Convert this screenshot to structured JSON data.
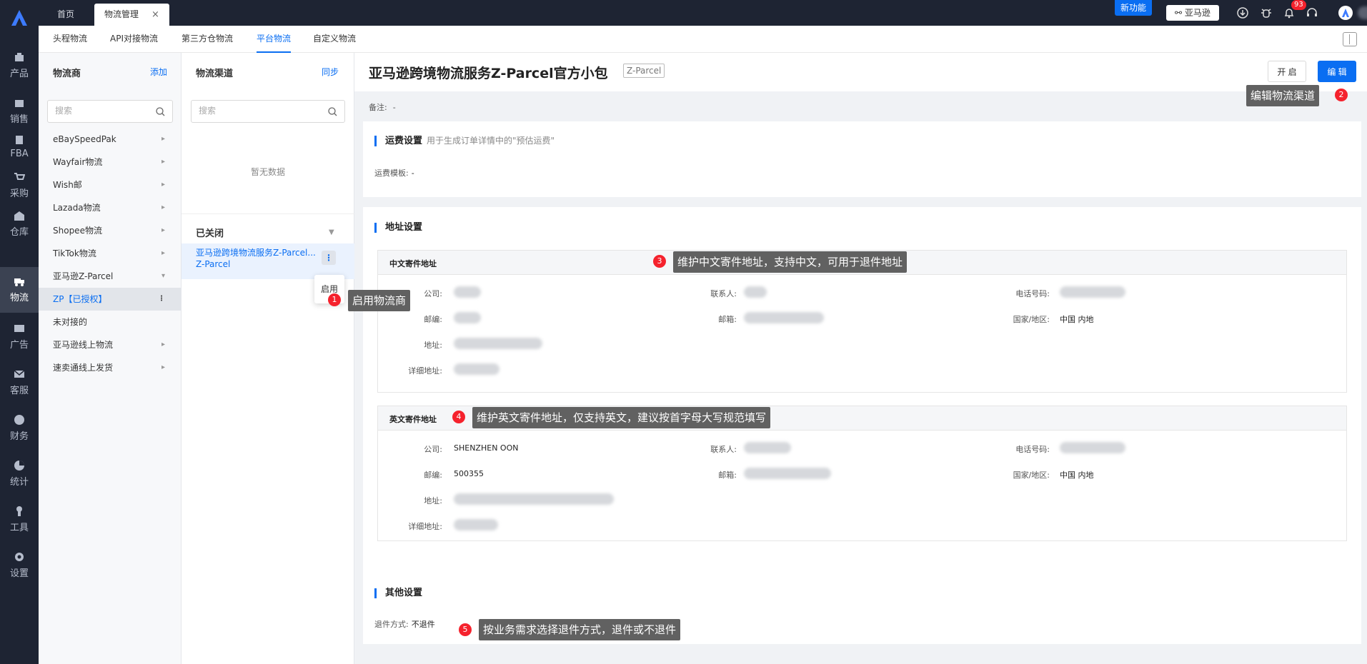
{
  "rail": {
    "items": [
      {
        "label": "产品",
        "icon": "product-icon"
      },
      {
        "label": "销售",
        "icon": "sales-icon"
      },
      {
        "label": "FBA",
        "icon": "fba-icon"
      },
      {
        "label": "采购",
        "icon": "cart-icon"
      },
      {
        "label": "仓库",
        "icon": "warehouse-icon"
      },
      {
        "label": "物流",
        "icon": "truck-icon"
      },
      {
        "label": "广告",
        "icon": "ad-icon"
      },
      {
        "label": "客服",
        "icon": "mail-icon"
      },
      {
        "label": "财务",
        "icon": "finance-icon"
      },
      {
        "label": "统计",
        "icon": "pie-icon"
      },
      {
        "label": "工具",
        "icon": "wrench-icon"
      },
      {
        "label": "设置",
        "icon": "gear-icon"
      }
    ]
  },
  "topbar": {
    "tabs": [
      {
        "label": "首页"
      },
      {
        "label": "物流管理",
        "close": "×"
      }
    ],
    "new_feature": "新功能",
    "amazon_btn": "亚马逊",
    "notif_count": "93"
  },
  "subnav": {
    "tabs": [
      "头程物流",
      "API对接物流",
      "第三方仓物流",
      "平台物流",
      "自定义物流"
    ],
    "active": "平台物流"
  },
  "providers": {
    "title": "物流商",
    "add": "添加",
    "search_placeholder": "搜索",
    "items": [
      "eBaySpeedPak",
      "Wayfair物流",
      "Wish邮",
      "Lazada物流",
      "Shopee物流",
      "TikTok物流",
      "亚马逊Z-Parcel",
      "ZP【已授权】",
      "未对接的",
      "亚马逊线上物流",
      "速卖通线上发货"
    ]
  },
  "channels": {
    "title": "物流渠道",
    "sync": "同步",
    "search_placeholder": "搜索",
    "empty": "暂无数据",
    "closed_title": "已关闭",
    "closed_item": "亚马逊跨境物流服务Z-Parcel...",
    "closed_item_sub": "Z-Parcel",
    "popup_enable": "启用"
  },
  "main": {
    "title": "亚马逊跨境物流服务Z-Parcel官方小包",
    "tag": "Z-Parcel",
    "btn_open": "开 启",
    "btn_edit": "编 辑",
    "remark_label": "备注:",
    "remark_value": "-",
    "freight": {
      "title": "运费设置",
      "hint": "用于生成订单详情中的\"预估运费\"",
      "template_label": "运费模板:",
      "template_value": "-"
    },
    "address": {
      "title": "地址设置",
      "cn": {
        "title": "中文寄件地址",
        "company": "公司:",
        "contact": "联系人:",
        "phone": "电话号码:",
        "zip": "邮编:",
        "email": "邮箱:",
        "country": "国家/地区:",
        "country_value": "中国 内地",
        "addr": "地址:",
        "detail": "详细地址:"
      },
      "en": {
        "title": "英文寄件地址",
        "company": "公司:",
        "company_value": "SHENZHEN OON",
        "contact": "联系人:",
        "phone": "电话号码:",
        "zip": "邮编:",
        "zip_value": "500355",
        "email": "邮箱:",
        "country": "国家/地区:",
        "country_value": "中国 内地",
        "addr": "地址:",
        "detail": "详细地址:"
      }
    },
    "other": {
      "title": "其他设置",
      "return_label": "退件方式:",
      "return_value": "不退件"
    }
  },
  "annotations": [
    {
      "num": "1",
      "text": "启用物流商"
    },
    {
      "num": "2",
      "text": "编辑物流渠道"
    },
    {
      "num": "3",
      "text": "维护中文寄件地址，支持中文，可用于退件地址"
    },
    {
      "num": "4",
      "text": "维护英文寄件地址，仅支持英文，建议按首字母大写规范填写"
    },
    {
      "num": "5",
      "text": "按业务需求选择退件方式，退件或不退件"
    }
  ]
}
